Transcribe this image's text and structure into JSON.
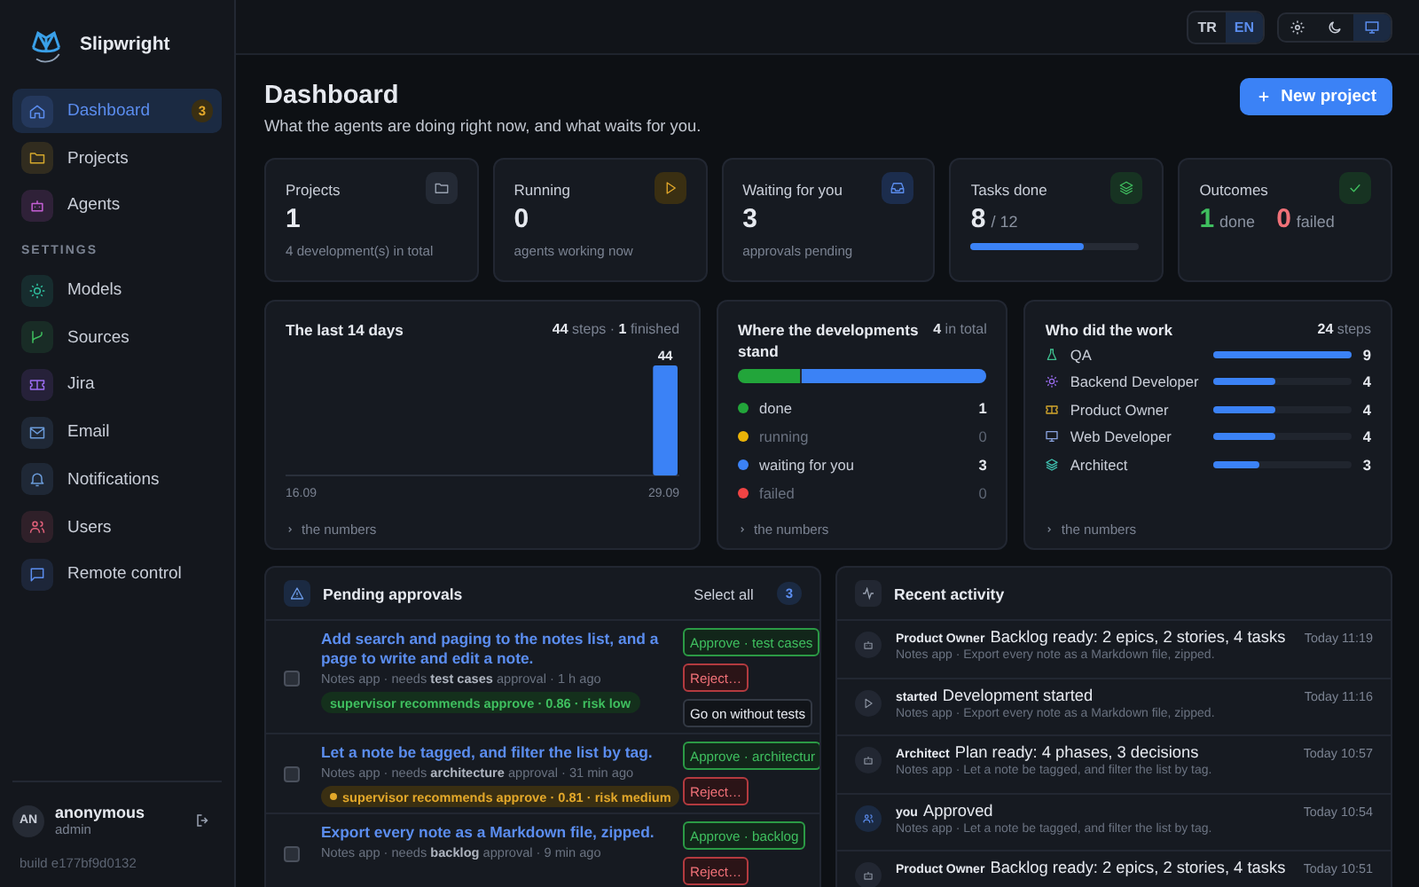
{
  "app": {
    "name": "Slipwright"
  },
  "sidebar": {
    "items": [
      {
        "label": "Dashboard",
        "selected": true,
        "badge": "3"
      },
      {
        "label": "Projects",
        "selected": false
      },
      {
        "label": "Agents",
        "selected": false
      }
    ],
    "section_title": "SETTINGS",
    "settings_items": [
      {
        "label": "Models",
        "selected": false
      },
      {
        "label": "Sources",
        "selected": false
      },
      {
        "label": "Jira",
        "selected": false
      },
      {
        "label": "Email",
        "selected": false
      },
      {
        "label": "Notifications",
        "selected": false
      },
      {
        "label": "Users",
        "selected": false
      },
      {
        "label": "Remote control",
        "selected": false
      }
    ],
    "user": {
      "initials": "AN",
      "name": "anonymous",
      "role": "admin"
    },
    "build": "build e177bf9d0132"
  },
  "topbar": {
    "languages": [
      {
        "label": "TR",
        "selected": false
      },
      {
        "label": "EN",
        "selected": true
      }
    ],
    "themes": [
      {
        "selected": false
      },
      {
        "selected": false
      },
      {
        "selected": true
      }
    ]
  },
  "header": {
    "title": "Dashboard",
    "subtitle": "What the agents are doing right now, and what waits for you.",
    "new_button": "New project"
  },
  "stats": [
    {
      "kind": "count",
      "label": "Projects",
      "value": "1",
      "note": "4 development(s) in total"
    },
    {
      "kind": "count",
      "label": "Running",
      "value": "0",
      "note": "agents working now"
    },
    {
      "kind": "count",
      "label": "Waiting for you",
      "value": "3",
      "note": "approvals pending"
    },
    {
      "kind": "progress",
      "label": "Tasks done",
      "value": "8",
      "total": "/ 12",
      "level": 0.67
    },
    {
      "kind": "outcome",
      "label": "Outcomes",
      "done": "1",
      "done_label": "done",
      "failed": "0",
      "failed_label": "failed"
    }
  ],
  "activity_chart": {
    "title": "The last 14 days",
    "summary": "**44** steps · **1** finished",
    "footer": "the numbers",
    "bar_label": "44",
    "axis_start": "16.09",
    "axis_end": "29.09"
  },
  "status_chart": {
    "title": "Where the developments stand",
    "summary": "**4** in total",
    "footer": "the numbers",
    "statuses": [
      {
        "label": "done",
        "count": "1",
        "color": "#22a53a",
        "level": 0.25,
        "muted": false
      },
      {
        "label": "running",
        "count": "0",
        "color": "#eab308",
        "level": 0,
        "muted": true
      },
      {
        "label": "waiting for you",
        "count": "3",
        "color": "#3b82f6",
        "level": 0.75,
        "muted": false
      },
      {
        "label": "failed",
        "count": "0",
        "color": "#ef4444",
        "level": 0,
        "muted": true
      }
    ]
  },
  "work_chart": {
    "title": "Who did the work",
    "summary": "**24** steps",
    "footer": "the numbers",
    "agents": [
      {
        "name": "QA",
        "level": 1,
        "count": "9"
      },
      {
        "name": "Backend Developer",
        "level": 0.44,
        "count": "4"
      },
      {
        "name": "Product Owner",
        "level": 0.44,
        "count": "4"
      },
      {
        "name": "Web Developer",
        "level": 0.44,
        "count": "4"
      },
      {
        "name": "Architect",
        "level": 0.33,
        "count": "3"
      }
    ]
  },
  "approvals": {
    "title": "Pending approvals",
    "select_all": "Select all",
    "count": "3",
    "items": [
      {
        "title": "Add search and paging to the notes list, and a page to write and edit a note.",
        "meta": "Notes app · needs **test cases** approval · 1 h ago",
        "checked": false,
        "recommendation": {
          "text": "supervisor recommends approve · 0.86 · risk low",
          "kind": "success"
        },
        "actions": [
          {
            "kind": "approve",
            "label": "Approve · test cases"
          },
          {
            "kind": "reject",
            "label": "Reject…"
          },
          {
            "kind": "neutral",
            "label": "Go on without tests"
          }
        ]
      },
      {
        "title": "Let a note be tagged, and filter the list by tag.",
        "meta": "Notes app · needs **architecture** approval · 31 min ago",
        "checked": false,
        "recommendation": {
          "text": "supervisor recommends approve · 0.81 · risk medium",
          "kind": "warning"
        },
        "actions": [
          {
            "kind": "approve",
            "label": "Approve · architectur"
          },
          {
            "kind": "reject",
            "label": "Reject…"
          }
        ]
      },
      {
        "title": "Export every note as a Markdown file, zipped.",
        "meta": "Notes app · needs **backlog** approval · 9 min ago",
        "checked": false,
        "actions": [
          {
            "kind": "approve",
            "label": "Approve · backlog"
          },
          {
            "kind": "reject",
            "label": "Reject…"
          }
        ]
      }
    ]
  },
  "activity": {
    "title": "Recent activity",
    "items": [
      {
        "kind": "agent",
        "actor": "Product Owner",
        "message": "Backlog ready: 2 epics, 2 stories, 4 tasks",
        "context": "Notes app · Export every note as a Markdown file, zipped.",
        "time": "Today 11:19"
      },
      {
        "kind": "started",
        "actor": "started",
        "message": "Development started",
        "context": "Notes app · Export every note as a Markdown file, zipped.",
        "time": "Today 11:16"
      },
      {
        "kind": "agent",
        "actor": "Architect",
        "message": "Plan ready: 4 phases, 3 decisions",
        "context": "Notes app · Let a note be tagged, and filter the list by tag.",
        "time": "Today 10:57"
      },
      {
        "kind": "you",
        "actor": "you",
        "message": "Approved",
        "context": "Notes app · Let a note be tagged, and filter the list by tag.",
        "time": "Today 10:54"
      },
      {
        "kind": "agent",
        "actor": "Product Owner",
        "message": "Backlog ready: 2 epics, 2 stories, 4 tasks",
        "time": "Today 10:51"
      }
    ]
  }
}
